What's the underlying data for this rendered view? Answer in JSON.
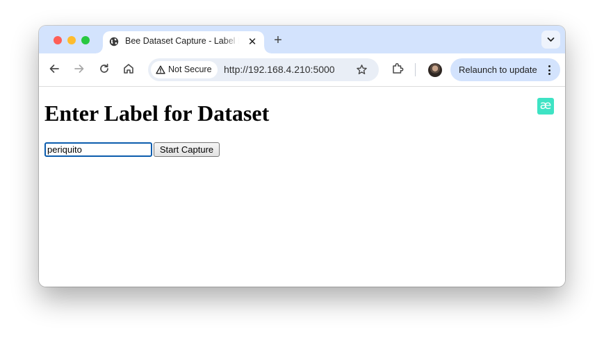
{
  "tab": {
    "title": "Bee Dataset Capture - Label Entry",
    "close_label": "✕"
  },
  "new_tab_label": "+",
  "omnibox": {
    "security_label": "Not Secure",
    "url": "http://192.168.4.210:5000"
  },
  "relaunch_label": "Relaunch to update",
  "page": {
    "heading": "Enter Label for Dataset",
    "input_value": "periquito",
    "button_label": "Start Capture",
    "extension_badge": "æ"
  },
  "colors": {
    "tab_strip": "#d3e3fd",
    "relaunch_pill": "#d3e3fd",
    "input_focus_border": "#0b5cad",
    "extension_badge": "#3ee3c4"
  },
  "icons": [
    "globe-icon",
    "close-icon",
    "plus-icon",
    "chevron-down-icon",
    "back-arrow-icon",
    "forward-arrow-icon",
    "reload-icon",
    "home-icon",
    "warning-icon",
    "star-icon",
    "puzzle-extension-icon",
    "avatar",
    "kebab-menu-icon"
  ]
}
